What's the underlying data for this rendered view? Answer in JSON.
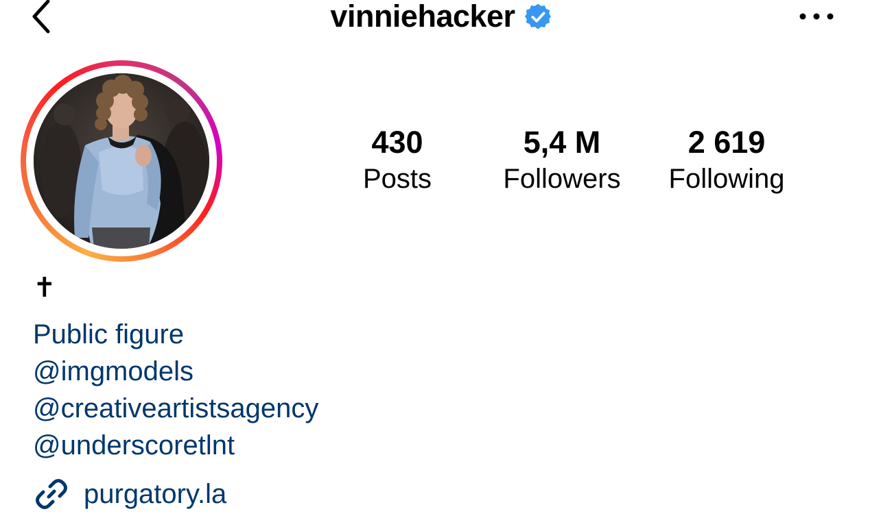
{
  "header": {
    "back_icon": "chevron-left-icon",
    "username": "vinniehacker",
    "verified_icon": "verified-badge-icon",
    "more_icon": "more-horizontal-icon"
  },
  "profile": {
    "avatar": "profile-photo",
    "story_ring_colors": [
      "#fcaf45",
      "#f77737",
      "#fd1d1d",
      "#e1306c",
      "#c13584",
      "#d300c5"
    ]
  },
  "stats": {
    "posts": {
      "value": "430",
      "label": "Posts"
    },
    "followers": {
      "value": "5,4 M",
      "label": "Followers"
    },
    "following": {
      "value": "2 619",
      "label": "Following"
    }
  },
  "bio": {
    "name": "✝",
    "category": "Public figure",
    "mentions": [
      "@imgmodels",
      "@creativeartistsagency",
      "@underscoretlnt"
    ],
    "link": {
      "icon": "link-icon",
      "text": "purgatory.la"
    }
  },
  "colors": {
    "text": "#000000",
    "link": "#00376b",
    "verified": "#3897f0"
  }
}
